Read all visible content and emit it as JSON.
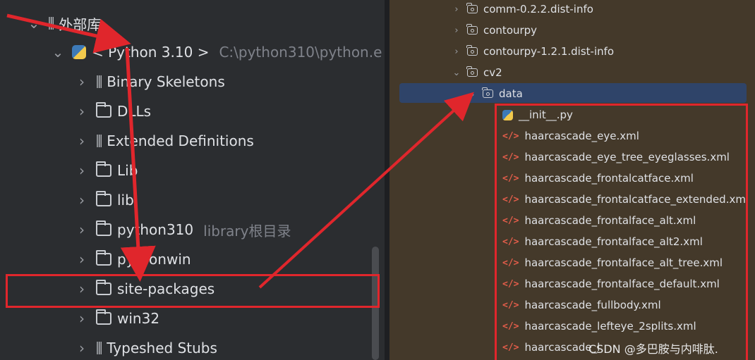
{
  "left_tree": {
    "root_label": "外部库",
    "sdk_label": "< Python 3.10 >",
    "sdk_path": "C:\\python310\\python.e",
    "items": [
      {
        "label": "Binary Skeletons",
        "icon": "library-icon"
      },
      {
        "label": "DLLs",
        "icon": "folder-icon"
      },
      {
        "label": "Extended Definitions",
        "icon": "library-icon"
      },
      {
        "label": "Lib",
        "icon": "folder-icon"
      },
      {
        "label": "lib",
        "icon": "folder-icon"
      },
      {
        "label": "python310",
        "icon": "folder-icon",
        "hint": "library根目录"
      },
      {
        "label": "pythonwin",
        "icon": "folder-icon"
      },
      {
        "label": "site-packages",
        "icon": "folder-icon"
      },
      {
        "label": "win32",
        "icon": "folder-icon"
      },
      {
        "label": "Typeshed Stubs",
        "icon": "library-icon"
      }
    ]
  },
  "right_tree": {
    "folders": [
      {
        "label": "comm-0.2.2.dist-info"
      },
      {
        "label": "contourpy"
      },
      {
        "label": "contourpy-1.2.1.dist-info"
      },
      {
        "label": "cv2"
      },
      {
        "label": "data"
      }
    ],
    "files": [
      {
        "label": "__init__.py",
        "icon": "python-file-icon"
      },
      {
        "label": "haarcascade_eye.xml",
        "icon": "xml-file-icon"
      },
      {
        "label": "haarcascade_eye_tree_eyeglasses.xml",
        "icon": "xml-file-icon"
      },
      {
        "label": "haarcascade_frontalcatface.xml",
        "icon": "xml-file-icon"
      },
      {
        "label": "haarcascade_frontalcatface_extended.xml",
        "icon": "xml-file-icon"
      },
      {
        "label": "haarcascade_frontalface_alt.xml",
        "icon": "xml-file-icon"
      },
      {
        "label": "haarcascade_frontalface_alt2.xml",
        "icon": "xml-file-icon"
      },
      {
        "label": "haarcascade_frontalface_alt_tree.xml",
        "icon": "xml-file-icon"
      },
      {
        "label": "haarcascade_frontalface_default.xml",
        "icon": "xml-file-icon"
      },
      {
        "label": "haarcascade_fullbody.xml",
        "icon": "xml-file-icon"
      },
      {
        "label": "haarcascade_lefteye_2splits.xml",
        "icon": "xml-file-icon"
      },
      {
        "label": "haarcascade_l",
        "icon": "xml-file-icon"
      }
    ]
  },
  "watermark": "CSDN @多巴胺与内啡肽.",
  "colors": {
    "annotation_red": "#e0262c",
    "selection_blue": "#2f4469",
    "right_bg": "#44392a",
    "left_bg": "#2b2d30"
  }
}
